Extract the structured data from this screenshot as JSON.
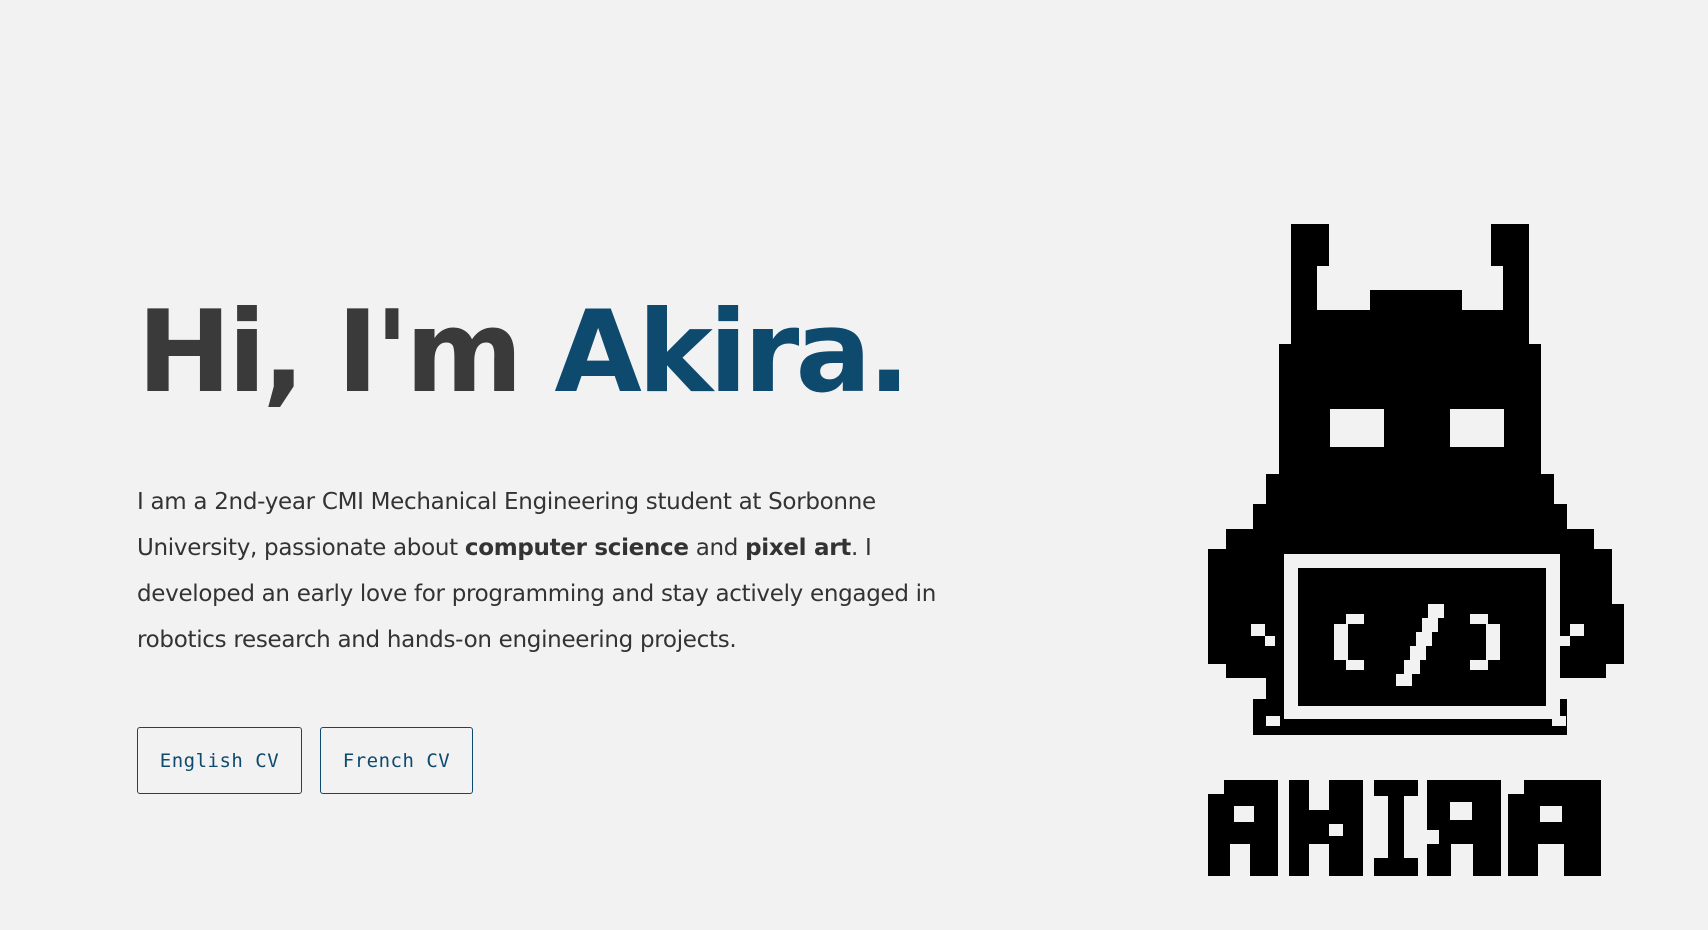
{
  "hero": {
    "greeting": "Hi, I'm",
    "name": "Akira."
  },
  "intro": {
    "part1": "I am a 2nd-year CMI Mechanical Engineering student at Sorbonne University, passionate about ",
    "strong1": "computer science",
    "part2": " and ",
    "strong2": "pixel art",
    "part3": ". I developed an early love for programming and stay actively engaged in robotics research and hands-on engineering projects."
  },
  "buttons": {
    "english_cv": "English CV",
    "french_cv": "French CV"
  },
  "mascot": {
    "logo_text": "AKIRA",
    "screen_glyph": "</>"
  },
  "colors": {
    "background": "#f2f2f2",
    "text": "#3a3a3a",
    "accent": "#0e4a6e",
    "pixel": "#000000"
  }
}
